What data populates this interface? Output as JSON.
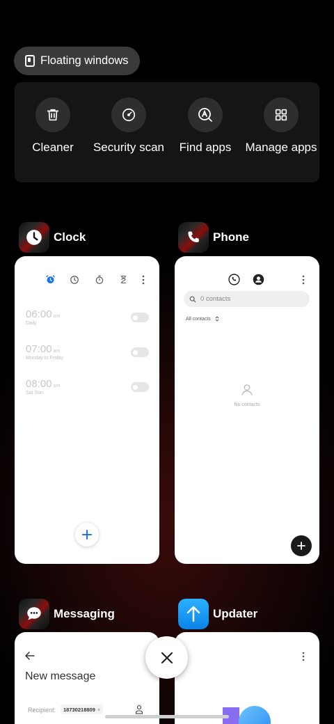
{
  "floating_windows": {
    "label": "Floating windows",
    "icon": "floating-window-icon"
  },
  "tools": [
    {
      "label": "Cleaner",
      "icon": "trash-icon"
    },
    {
      "label": "Security scan",
      "icon": "security-scan-icon"
    },
    {
      "label": "Find apps",
      "icon": "find-apps-icon"
    },
    {
      "label": "Manage apps",
      "icon": "manage-apps-icon"
    }
  ],
  "apps": {
    "clock": {
      "title": "Clock",
      "alarms": [
        {
          "time": "06:00",
          "ampm": "am",
          "repeat": "Daily",
          "enabled": false
        },
        {
          "time": "07:00",
          "ampm": "am",
          "repeat": "Monday to Friday",
          "enabled": false
        },
        {
          "time": "08:00",
          "ampm": "am",
          "repeat": "Sat Sun",
          "enabled": false
        }
      ],
      "accent_color": "#1a73e8"
    },
    "phone": {
      "title": "Phone",
      "search_placeholder": "0 contacts",
      "filter": "All contacts",
      "empty_text": "No contacts"
    },
    "messaging": {
      "title": "Messaging",
      "header": "New message",
      "recipient_label": "Recipient:",
      "recipient_value": "18730218809"
    },
    "updater": {
      "title": "Updater",
      "accent_color": "#1c9cf6"
    }
  },
  "controls": {
    "close_all": "close-icon"
  }
}
